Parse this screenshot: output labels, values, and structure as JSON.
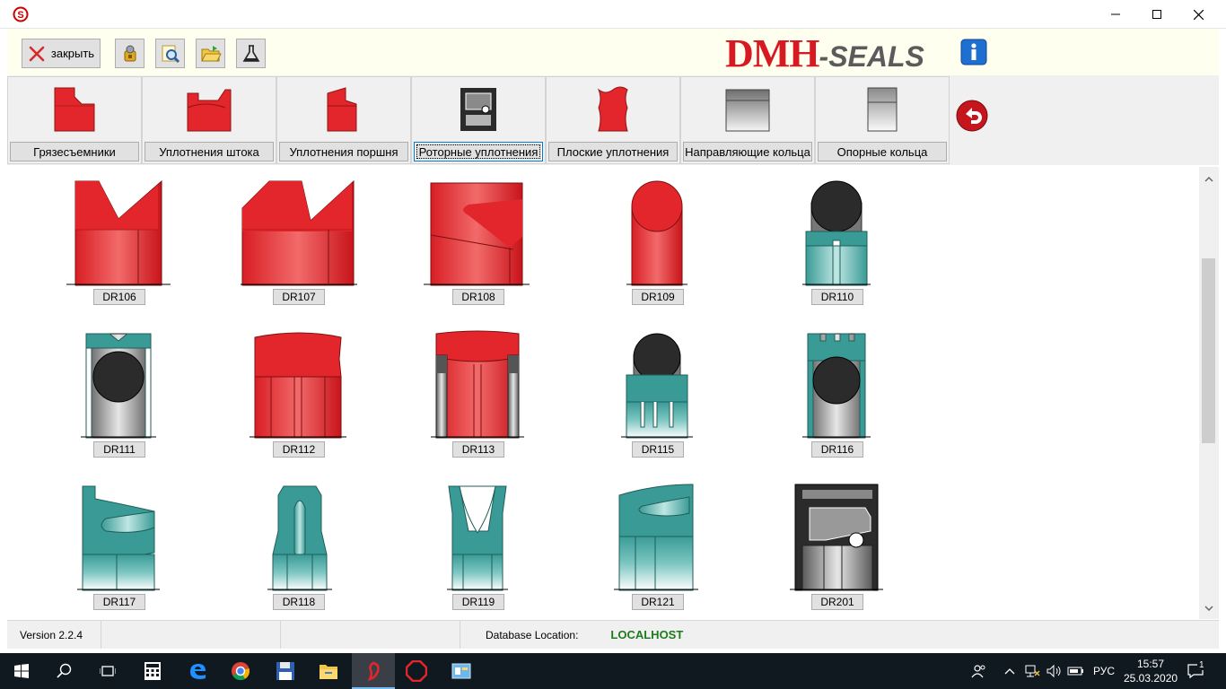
{
  "window": {
    "minimize_icon": "minimize-icon",
    "maximize_icon": "maximize-icon",
    "close_icon": "close-icon"
  },
  "toolbar": {
    "close_label": "закрыть",
    "buttons": [
      "tools-icon",
      "search-icon",
      "open-folder-icon",
      "flask-icon"
    ],
    "logo_main": "DMH",
    "logo_sub": "-SEALS",
    "info_icon": "info-icon"
  },
  "categories": [
    {
      "label": "Грязесъемники",
      "active": false
    },
    {
      "label": "Уплотнения штока",
      "active": false
    },
    {
      "label": "Уплотнения поршня",
      "active": false
    },
    {
      "label": "Роторные уплотнения",
      "active": true
    },
    {
      "label": "Плоские уплотнения",
      "active": false
    },
    {
      "label": "Направляющие кольца",
      "active": false
    },
    {
      "label": "Опорные кольца",
      "active": false
    }
  ],
  "items": [
    {
      "label": "DR106"
    },
    {
      "label": "DR107"
    },
    {
      "label": "DR108"
    },
    {
      "label": "DR109"
    },
    {
      "label": "DR110"
    },
    {
      "label": "DR111"
    },
    {
      "label": "DR112"
    },
    {
      "label": "DR113"
    },
    {
      "label": "DR115"
    },
    {
      "label": "DR116"
    },
    {
      "label": "DR117"
    },
    {
      "label": "DR118"
    },
    {
      "label": "DR119"
    },
    {
      "label": "DR121"
    },
    {
      "label": "DR201"
    }
  ],
  "status": {
    "version": "Version 2.2.4",
    "db_label": "Database Location:",
    "db_value": "LOCALHOST"
  },
  "taskbar": {
    "language": "РУС",
    "time": "15:57",
    "date": "25.03.2020",
    "notification_count": "1"
  },
  "colors": {
    "seal_red": "#e3262b",
    "seal_teal": "#3a9b96",
    "seal_dark": "#2b2b2b",
    "logo_red": "#d71921",
    "db_green": "#1e7b1e"
  }
}
